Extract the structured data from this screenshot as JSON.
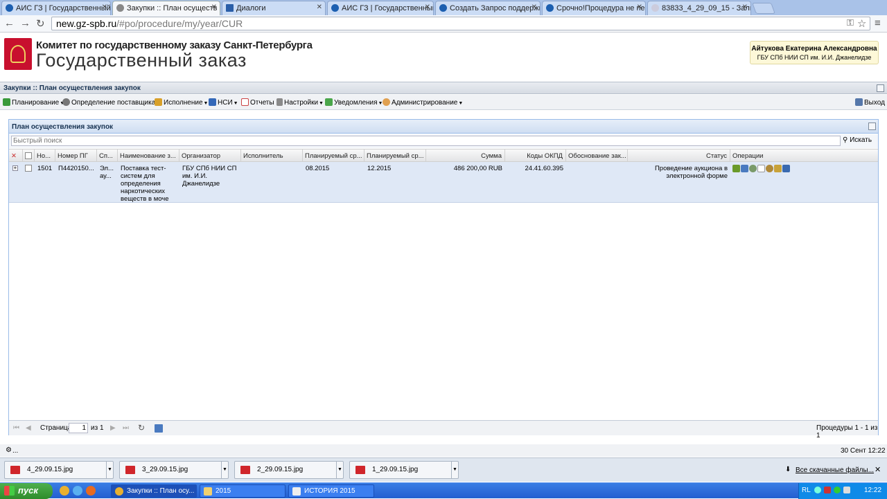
{
  "browser": {
    "tabs": [
      {
        "title": "АИС ГЗ | Государственный",
        "active": false
      },
      {
        "title": "Закупки :: План осуществ",
        "active": true
      },
      {
        "title": "Диалоги",
        "active": false
      },
      {
        "title": "АИС ГЗ | Государственный",
        "active": false
      },
      {
        "title": "Создать Запрос поддержк",
        "active": false
      },
      {
        "title": "Срочно!Процедура не пере",
        "active": false
      },
      {
        "title": "83833_4_29_09_15 - Залив",
        "active": false
      }
    ],
    "url_host": "new.gz-spb.ru",
    "url_path": "/#po/procedure/my/year/CUR"
  },
  "header": {
    "org_line1": "Комитет по государственному заказу Санкт-Петербурга",
    "org_line2": "Государственный заказ",
    "user_name": "Айтукова Екатерина Александровна",
    "user_org": "ГБУ СПб НИИ СП им. И.И. Джанелидзе"
  },
  "panel": {
    "title": "Закупки :: План осуществления закупок"
  },
  "menu": {
    "items": [
      "Планирование",
      "Определение поставщика",
      "Исполнение",
      "НСИ",
      "Отчеты",
      "Настройки",
      "Уведомления",
      "Администрирование"
    ],
    "exit": "Выход"
  },
  "grid": {
    "title": "План осуществления закупок",
    "search_placeholder": "Быстрый поиск",
    "search_button": "Искать",
    "columns": [
      "Но...",
      "Номер ПГ",
      "Сп...",
      "Наименование з...",
      "Организатор",
      "Исполнитель",
      "Планируемый ср...",
      "Планируемый ср...",
      "Сумма",
      "Коды ОКПД",
      "Обоснование зак...",
      "Статус",
      "Операции"
    ],
    "row": {
      "num": "1501",
      "pg_number": "П4420150...",
      "method": "Эл... ау...",
      "name": "Поставка тест-систем для определения наркотических веществ в моче",
      "organizer": "ГБУ СПб НИИ СП им. И.И. Джанелидзе",
      "executor": "",
      "planned_start": "08.2015",
      "planned_end": "12.2015",
      "sum": "486 200,00 RUB",
      "okpd": "24.41.60.395",
      "justification": "",
      "status": "Проведение аукциона в электронной форме"
    },
    "pager": {
      "page_label": "Страница",
      "page_value": "1",
      "of_label": "из 1",
      "summary": "Процедуры 1 - 1 из 1"
    }
  },
  "statusbar": {
    "left": "...",
    "datetime": "30 Сент 12:22"
  },
  "downloads": {
    "files": [
      "4_29.09.15.jpg",
      "3_29.09.15.jpg",
      "2_29.09.15.jpg",
      "1_29.09.15.jpg"
    ],
    "all_label": "Все скачанные файлы..."
  },
  "taskbar": {
    "start": "пуск",
    "tasks": [
      "Закупки :: План осу...",
      "2015",
      "ИСТОРИЯ 2015"
    ],
    "lang": "RL",
    "clock": "12:22"
  },
  "colors": {
    "accent": "#99bbe8",
    "row_selected": "#dfe8f6",
    "brand_red": "#c8102e"
  }
}
